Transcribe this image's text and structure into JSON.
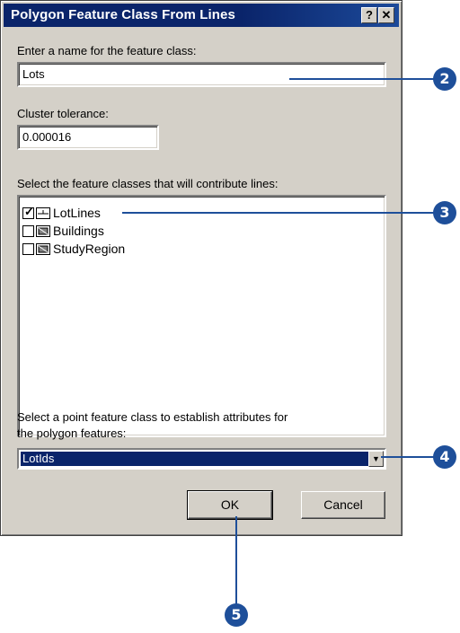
{
  "window": {
    "title": "Polygon Feature Class From Lines",
    "help_label": "?",
    "close_label": "✕"
  },
  "name_section": {
    "label": "Enter a name for the feature class:",
    "value": "Lots"
  },
  "tolerance_section": {
    "label": "Cluster tolerance:",
    "value": "0.000016"
  },
  "lines_section": {
    "label": "Select the feature classes that will contribute lines:",
    "items": [
      {
        "label": "LotLines",
        "checked": true,
        "icon": "line-feature-icon"
      },
      {
        "label": "Buildings",
        "checked": false,
        "icon": "polygon-feature-icon"
      },
      {
        "label": "StudyRegion",
        "checked": false,
        "icon": "polygon-feature-icon"
      }
    ]
  },
  "point_section": {
    "label_line1": "Select a point feature class to establish attributes for",
    "label_line2": "the polygon features:",
    "selected": "LotIds"
  },
  "buttons": {
    "ok_label": "OK",
    "cancel_label": "Cancel"
  },
  "callouts": [
    "2",
    "3",
    "4",
    "5"
  ],
  "colors": {
    "titlebar": "#0a246a",
    "dialog_face": "#d4d0c8",
    "callout": "#1e4f9a",
    "selection": "#0a246a"
  }
}
